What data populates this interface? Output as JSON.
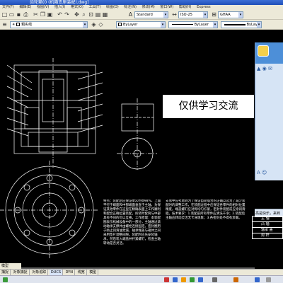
{
  "window": {
    "title": "齿轮箱(0 (机箱支座装配).dwg]"
  },
  "menu": [
    "文件(F)",
    "编辑(E)",
    "视图(V)",
    "插入(I)",
    "格式(O)",
    "工具(T)",
    "绘图(D)",
    "标注(N)",
    "修改(M)",
    "窗口(W)",
    "帮助(H)",
    "Express"
  ],
  "toolbar1": {
    "text_style": "Standard",
    "dim_style": "ISO-25",
    "extra_style": "GHAA",
    "print_icon": "printer-icon",
    "save_icon": "save-icon"
  },
  "toolbar2": {
    "layer": "粗实线",
    "color": "ByLayer",
    "linetype": "ByLayer",
    "lineweight": "ByLayer"
  },
  "watermark": "仅供学习交流",
  "description": {
    "left": "特点：装配后应保证Φ50为Φ98%、上面平行于端面和中部端面垂直于主轴。为保证其他零件在这里在精确表面上工作顺利和配合正确位置装配。拆装时套筒与中部具有不同的可以互换。工作原理：本装配图表示机械设备中的一部分，主轴通过滚动轴承支撑并由螺栓连接固定。密封圈用于防止润滑油泄漏，轴承端盖与箱体之间采用垫片调整间隙。装配时应先安装轴承，然后装入端盖并拧紧螺钉，检查主轴转动是否灵活。",
    "right": "支承中应考虑到为了保证齿轮啮合的正确以及为了减少装配时的调整工作，在装配过程中应保证各零件的相对位置精度。端盖螺钉应对称均匀拧紧，密封件装配前应涂润滑脂。技术要求：1.装配前所有零件应清洗干净；2.装配后主轴应转动灵活无卡滞现象；3.各密封处不得有渗漏。"
  },
  "chat": {
    "row_icons": "▲ ◉ ✉",
    "bottom_text": "亮是快乐，来到"
  },
  "title_block": {
    "rows": [
      "主 轴",
      "凸  轴",
      "轴承 盖",
      "封   杆"
    ]
  },
  "tab": "模型",
  "statusbar": [
    "捕捉",
    "对象捕捉",
    "对象追踪",
    "DUCS",
    "DYN",
    "线宽",
    "模型"
  ]
}
